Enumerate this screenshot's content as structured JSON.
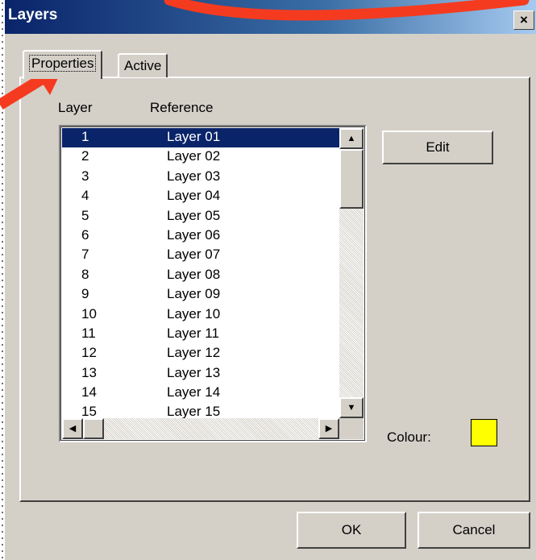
{
  "window": {
    "title": "Layers",
    "close_label": "×"
  },
  "tabs": [
    {
      "label": "Properties",
      "selected": true
    },
    {
      "label": "Active",
      "selected": false
    }
  ],
  "list": {
    "columns": {
      "layer": "Layer",
      "reference": "Reference"
    },
    "rows": [
      {
        "n": "1",
        "ref": "Layer 01"
      },
      {
        "n": "2",
        "ref": "Layer 02"
      },
      {
        "n": "3",
        "ref": "Layer 03"
      },
      {
        "n": "4",
        "ref": "Layer 04"
      },
      {
        "n": "5",
        "ref": "Layer 05"
      },
      {
        "n": "6",
        "ref": "Layer 06"
      },
      {
        "n": "7",
        "ref": "Layer 07"
      },
      {
        "n": "8",
        "ref": "Layer 08"
      },
      {
        "n": "9",
        "ref": "Layer 09"
      },
      {
        "n": "10",
        "ref": "Layer 10"
      },
      {
        "n": "11",
        "ref": "Layer 11"
      },
      {
        "n": "12",
        "ref": "Layer 12"
      },
      {
        "n": "13",
        "ref": "Layer 13"
      },
      {
        "n": "14",
        "ref": "Layer 14"
      },
      {
        "n": "15",
        "ref": "Layer 15"
      }
    ],
    "selected_index": 0
  },
  "buttons": {
    "edit": "Edit",
    "ok": "OK",
    "cancel": "Cancel"
  },
  "colour": {
    "label": "Colour:",
    "value": "#ffff00"
  },
  "icons": {
    "up": "▲",
    "down": "▼",
    "left": "◀",
    "right": "▶"
  },
  "colors": {
    "annotation": "#f53b1f",
    "titlebar": "#0a246a",
    "selection": "#0a246a"
  }
}
